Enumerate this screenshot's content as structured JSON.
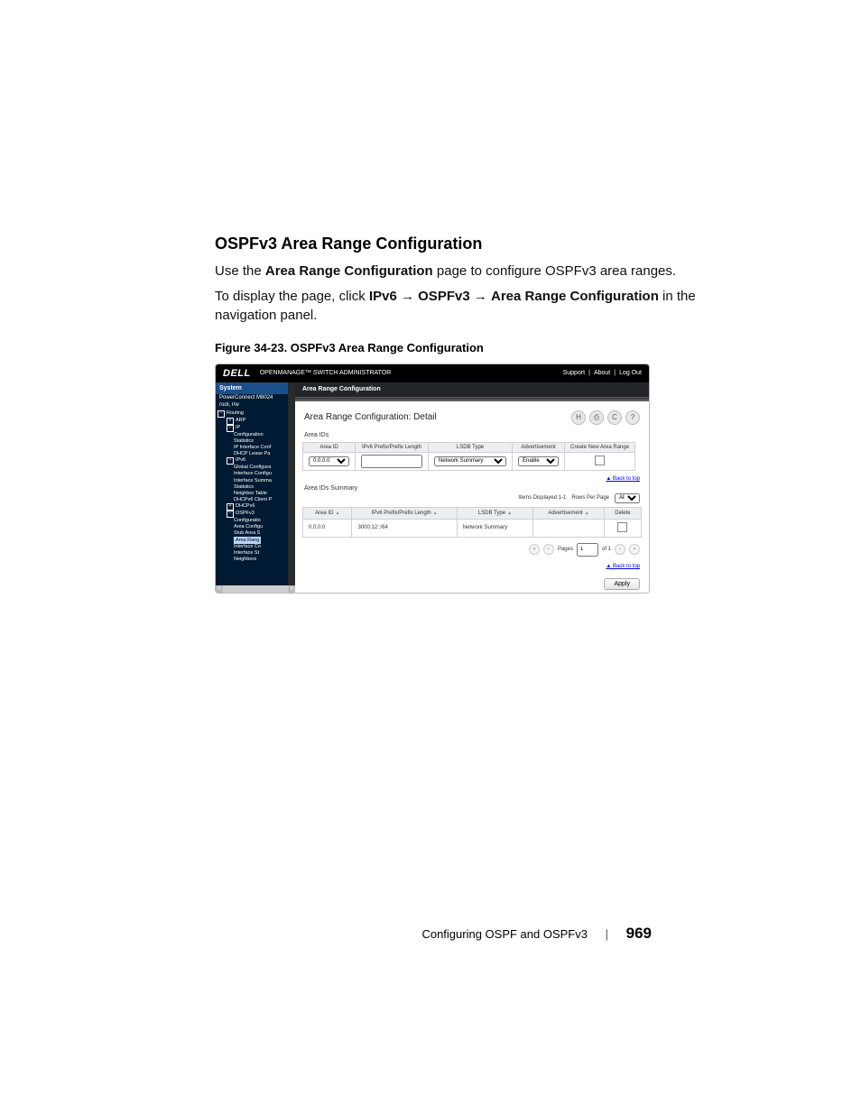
{
  "heading": "OSPFv3 Area Range Configuration",
  "para1_a": "Use the ",
  "para1_b": "Area Range Configuration",
  "para1_c": " page to configure OSPFv3 area ranges.",
  "para2_a": "To display the page, click ",
  "para2_b": "IPv6",
  "para2_arrow": " → ",
  "para2_c": "OSPFv3",
  "para2_d": "Area Range Configuration",
  "para2_e": " in the navigation panel.",
  "fig_caption": "Figure 34-23.    OSPFv3 Area Range Configuration",
  "shot": {
    "brand": "DELL",
    "product": "OPENMANAGE™ SWITCH ADMINISTRATOR",
    "top_links": [
      "Support",
      "About",
      "Log Out"
    ],
    "nav_head": "System",
    "nav_sub1": "PowerConnect M8024",
    "nav_sub2": "root, r/w",
    "nav_items": [
      "Routing",
      "ARP",
      "IP",
      "Configuration",
      "Statistics",
      "IP Interface Conf",
      "DHCP Lease Pa",
      "IPv6",
      "Global Configura",
      "Interface Configu",
      "Interface Summa",
      "Statistics",
      "Neighbor Table",
      "DHCPv6 Client P",
      "DHCPv6",
      "OSPFv3",
      "Configuratio",
      "Area Configu",
      "Stub Area S",
      "Area Rang",
      "Interface Co",
      "Interface St",
      "Neighbors"
    ],
    "nav_selected": "Area Rang",
    "bar_dark": "Area Range Configuration",
    "detail_title": "Area Range Configuration: Detail",
    "sec_area_ids": "Area IDs",
    "cols1": {
      "area_id": "Area ID",
      "prefix": "IPv6 Prefix/Prefix Length",
      "lsdb": "LSDB Type",
      "adv": "Advertisement",
      "create": "Create New Area Range"
    },
    "vals1": {
      "area_id": "0.0.0.0",
      "lsdb": "Network Summary",
      "adv": "Enable"
    },
    "back_to_top": "▲ Back to top",
    "sec_summary": "Area IDs Summary",
    "items_disp": "Items Displayed 1-1",
    "rows_per_page": "Rows Per Page",
    "rows_per_page_val": "All",
    "cols2": {
      "area_id": "Area ID",
      "prefix": "IPv6 Prefix/Prefix Length",
      "lsdb": "LSDB Type",
      "adv": "Advertisement",
      "delete": "Delete"
    },
    "row2": {
      "area_id": "0.0.0.0",
      "prefix": "3000:12::/64",
      "lsdb": "Network Summary"
    },
    "pager_pages": "Pages",
    "pager_val": "1",
    "pager_of": "of 1",
    "apply": "Apply"
  },
  "footer": {
    "section": "Configuring OSPF and OSPFv3",
    "page": "969"
  }
}
